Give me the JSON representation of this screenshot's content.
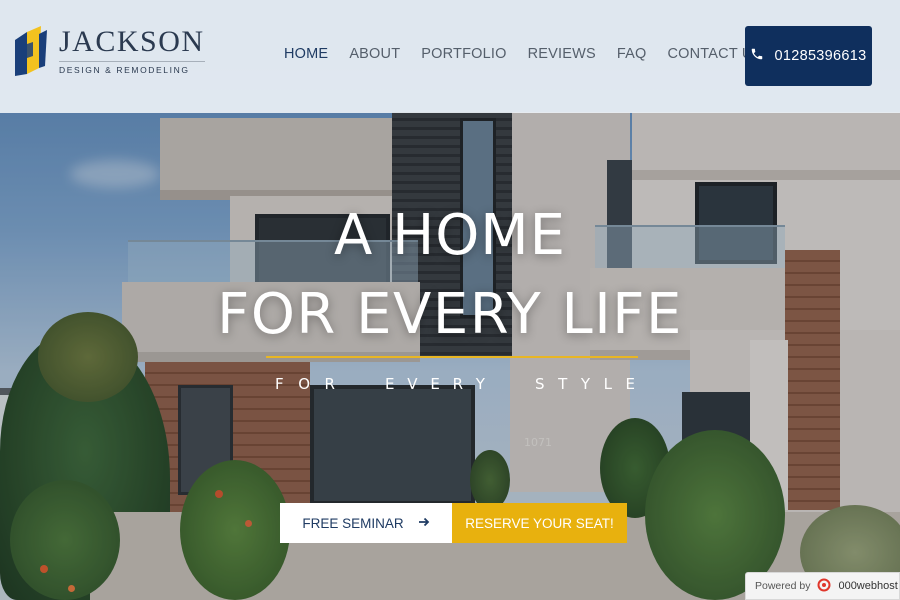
{
  "brand": {
    "name": "JACKSON",
    "subtitle": "DESIGN & REMODELING",
    "colors": {
      "navy": "#0f2f5d",
      "gold": "#e8b10e",
      "logo_blue": "#1a3f7a",
      "logo_yellow": "#f3c21f"
    }
  },
  "nav": {
    "items": [
      {
        "label": "HOME",
        "active": true
      },
      {
        "label": "ABOUT",
        "active": false
      },
      {
        "label": "PORTFOLIO",
        "active": false
      },
      {
        "label": "REVIEWS",
        "active": false
      },
      {
        "label": "FAQ",
        "active": false
      },
      {
        "label": "CONTACT US",
        "active": false
      }
    ]
  },
  "phone": {
    "icon": "phone-icon",
    "number": "01285396613"
  },
  "hero": {
    "headline_line1": "A HOME",
    "headline_line2": "FOR EVERY LIFE",
    "tagline_words": [
      "FOR",
      "EVERY",
      "STYLE"
    ],
    "house_number": "1071"
  },
  "cta": {
    "seminar_label": "FREE SEMINAR",
    "seminar_icon": "arrow-right-icon",
    "reserve_label": "RESERVE YOUR SEAT!"
  },
  "footer_badge": {
    "prefix": "Powered by",
    "brand": "000webhost"
  }
}
